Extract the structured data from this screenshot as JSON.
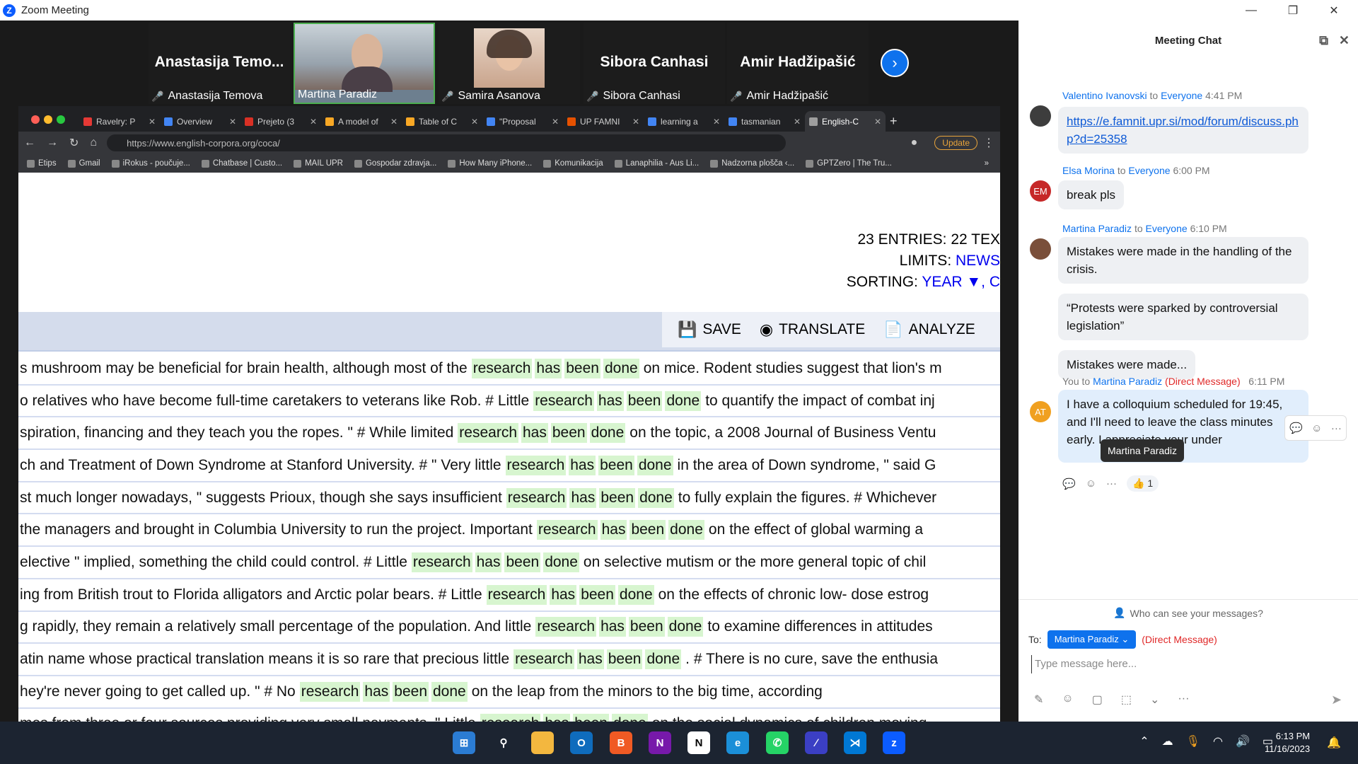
{
  "window": {
    "title": "Zoom Meeting",
    "controls": {
      "minimize": "—",
      "restore": "❐",
      "close": "✕"
    }
  },
  "gallery": {
    "tiles": [
      {
        "big_name": "Anastasija  Temo...",
        "label": "Anastasija Temova",
        "muted": true
      },
      {
        "big_name": "",
        "label": "Martina Paradiz",
        "muted": false
      },
      {
        "big_name": "",
        "label": "Samira Asanova",
        "muted": true
      },
      {
        "big_name": "Sibora Canhasi",
        "label": "Sibora Canhasi",
        "muted": true
      },
      {
        "big_name": "Amir Hadžipašić",
        "label": "Amir Hadžipašić",
        "muted": true
      }
    ],
    "next_icon": "›"
  },
  "browser": {
    "tabs": [
      {
        "label": "Ravelry: P",
        "favicon_color": "#e53935"
      },
      {
        "label": "Overview",
        "favicon_color": "#4285f4"
      },
      {
        "label": "Prejeto (3",
        "favicon_color": "#d93025"
      },
      {
        "label": "A model of",
        "favicon_color": "#f9a825"
      },
      {
        "label": "Table of C",
        "favicon_color": "#f9a825"
      },
      {
        "label": "\"Proposal",
        "favicon_color": "#4285f4"
      },
      {
        "label": "UP FAMNI",
        "favicon_color": "#e65100"
      },
      {
        "label": "learning a",
        "favicon_color": "#4285f4"
      },
      {
        "label": "tasmanian",
        "favicon_color": "#4285f4"
      },
      {
        "label": "English-C",
        "favicon_color": "#9e9e9e",
        "active": true
      }
    ],
    "new_tab": "+",
    "url": "https://www.english-corpora.org/coca/",
    "update_label": "Update",
    "bookmarks": [
      "Etips",
      "Gmail",
      "iRokus - poučuje...",
      "Chatbase | Custo...",
      "MAIL UPR",
      "Gospodar zdravja...",
      "How Many iPhone...",
      "Komunikacija",
      "Lanaphilia - Aus Li...",
      "Nadzorna plošča ‹...",
      "GPTZero | The Tru..."
    ],
    "more_bookmarks": "»"
  },
  "corpus": {
    "entries_text": "23 ENTRIES: 22 TEX",
    "limits_label": "LIMITS: ",
    "limits_value": "NEWS",
    "sorting_label": "SORTING: ",
    "sorting_value": "YEAR ▼, C",
    "toolbar": {
      "save": "SAVE",
      "translate": "TRANSLATE",
      "analyze": "ANALYZE"
    },
    "kw": [
      "research",
      "has",
      "been",
      "done"
    ],
    "rows": [
      {
        "left": "s mushroom may be beneficial for brain health, although most of the",
        "right": "on mice. Rodent studies suggest that lion's m"
      },
      {
        "left": "o relatives who have become full-time caretakers to veterans like Rob. # Little",
        "right": "to quantify the impact of combat inj"
      },
      {
        "left": "spiration, financing and they teach you the ropes. \" # While limited",
        "right": "on the topic, a 2008 Journal of Business Ventu"
      },
      {
        "left": "ch and Treatment of Down Syndrome at Stanford University. # \" Very little",
        "right": "in the area of Down syndrome, \" said G"
      },
      {
        "left": "st much longer nowadays, \" suggests Prioux, though she says insufficient",
        "right": "to fully explain the figures. # Whichever"
      },
      {
        "left": "the managers and brought in Columbia University to run the project. Important",
        "right": "on the effect of global warming a"
      },
      {
        "left": "elective \" implied, something the child could control. # Little",
        "right": "on selective mutism or the more general topic of chil"
      },
      {
        "left": "ing from British trout to Florida alligators and Arctic polar bears. # Little",
        "right": "on the effects of chronic low- dose estrog"
      },
      {
        "left": "g rapidly, they remain a relatively small percentage of the population. And little",
        "right": "to examine differences in attitudes"
      },
      {
        "left": "atin name whose practical translation means it is so rare that precious little",
        "right": ". # There is no cure, save the enthusia"
      },
      {
        "left": "hey're never going to get called up. \" # No",
        "right": "on the leap from the minors to the big time, according"
      },
      {
        "left": "mes from three or four sources providing very small payments. \" Little",
        "right": "on the social dynamics of children moving"
      }
    ]
  },
  "chat": {
    "title": "Meeting Chat",
    "messages": [
      {
        "avatar_text": "",
        "sender": "Valentino Ivanovski",
        "to_word": "to",
        "recipient": "Everyone",
        "time": "4:41 PM",
        "bubbles": [
          "https://e.famnit.upr.si/mod/forum/discuss.php?d=25358"
        ]
      },
      {
        "avatar_text": "EM",
        "sender": "Elsa Morina",
        "to_word": "to",
        "recipient": "Everyone",
        "time": "6:00 PM",
        "bubbles": [
          "break pls"
        ]
      },
      {
        "avatar_text": "",
        "sender": "Martina Paradiz",
        "to_word": "to",
        "recipient": "Everyone",
        "time": "6:10 PM",
        "bubbles": [
          "Mistakes were made in the handling of the crisis.",
          "“Protests were sparked by controversial legislation”",
          "Mistakes were made..."
        ]
      },
      {
        "avatar_text": "AT",
        "sender": "You",
        "to_word": "to",
        "recipient": "Martina Paradiz",
        "dm": "(Direct Message)",
        "time": "6:11 PM",
        "bubbles": [
          "I have a colloquium scheduled for 19:45, and I'll need to leave the class minutes early. I appreciate your under"
        ]
      }
    ],
    "tooltip": "Martina Paradiz",
    "reaction": "👍 1",
    "who_can_see": "Who can see your messages?",
    "to_label": "To:",
    "to_value": "Martina Paradiz",
    "to_dm": "(Direct Message)",
    "input_placeholder": "Type message here..."
  },
  "taskbar": {
    "time": "6:13 PM",
    "date": "11/16/2023"
  }
}
